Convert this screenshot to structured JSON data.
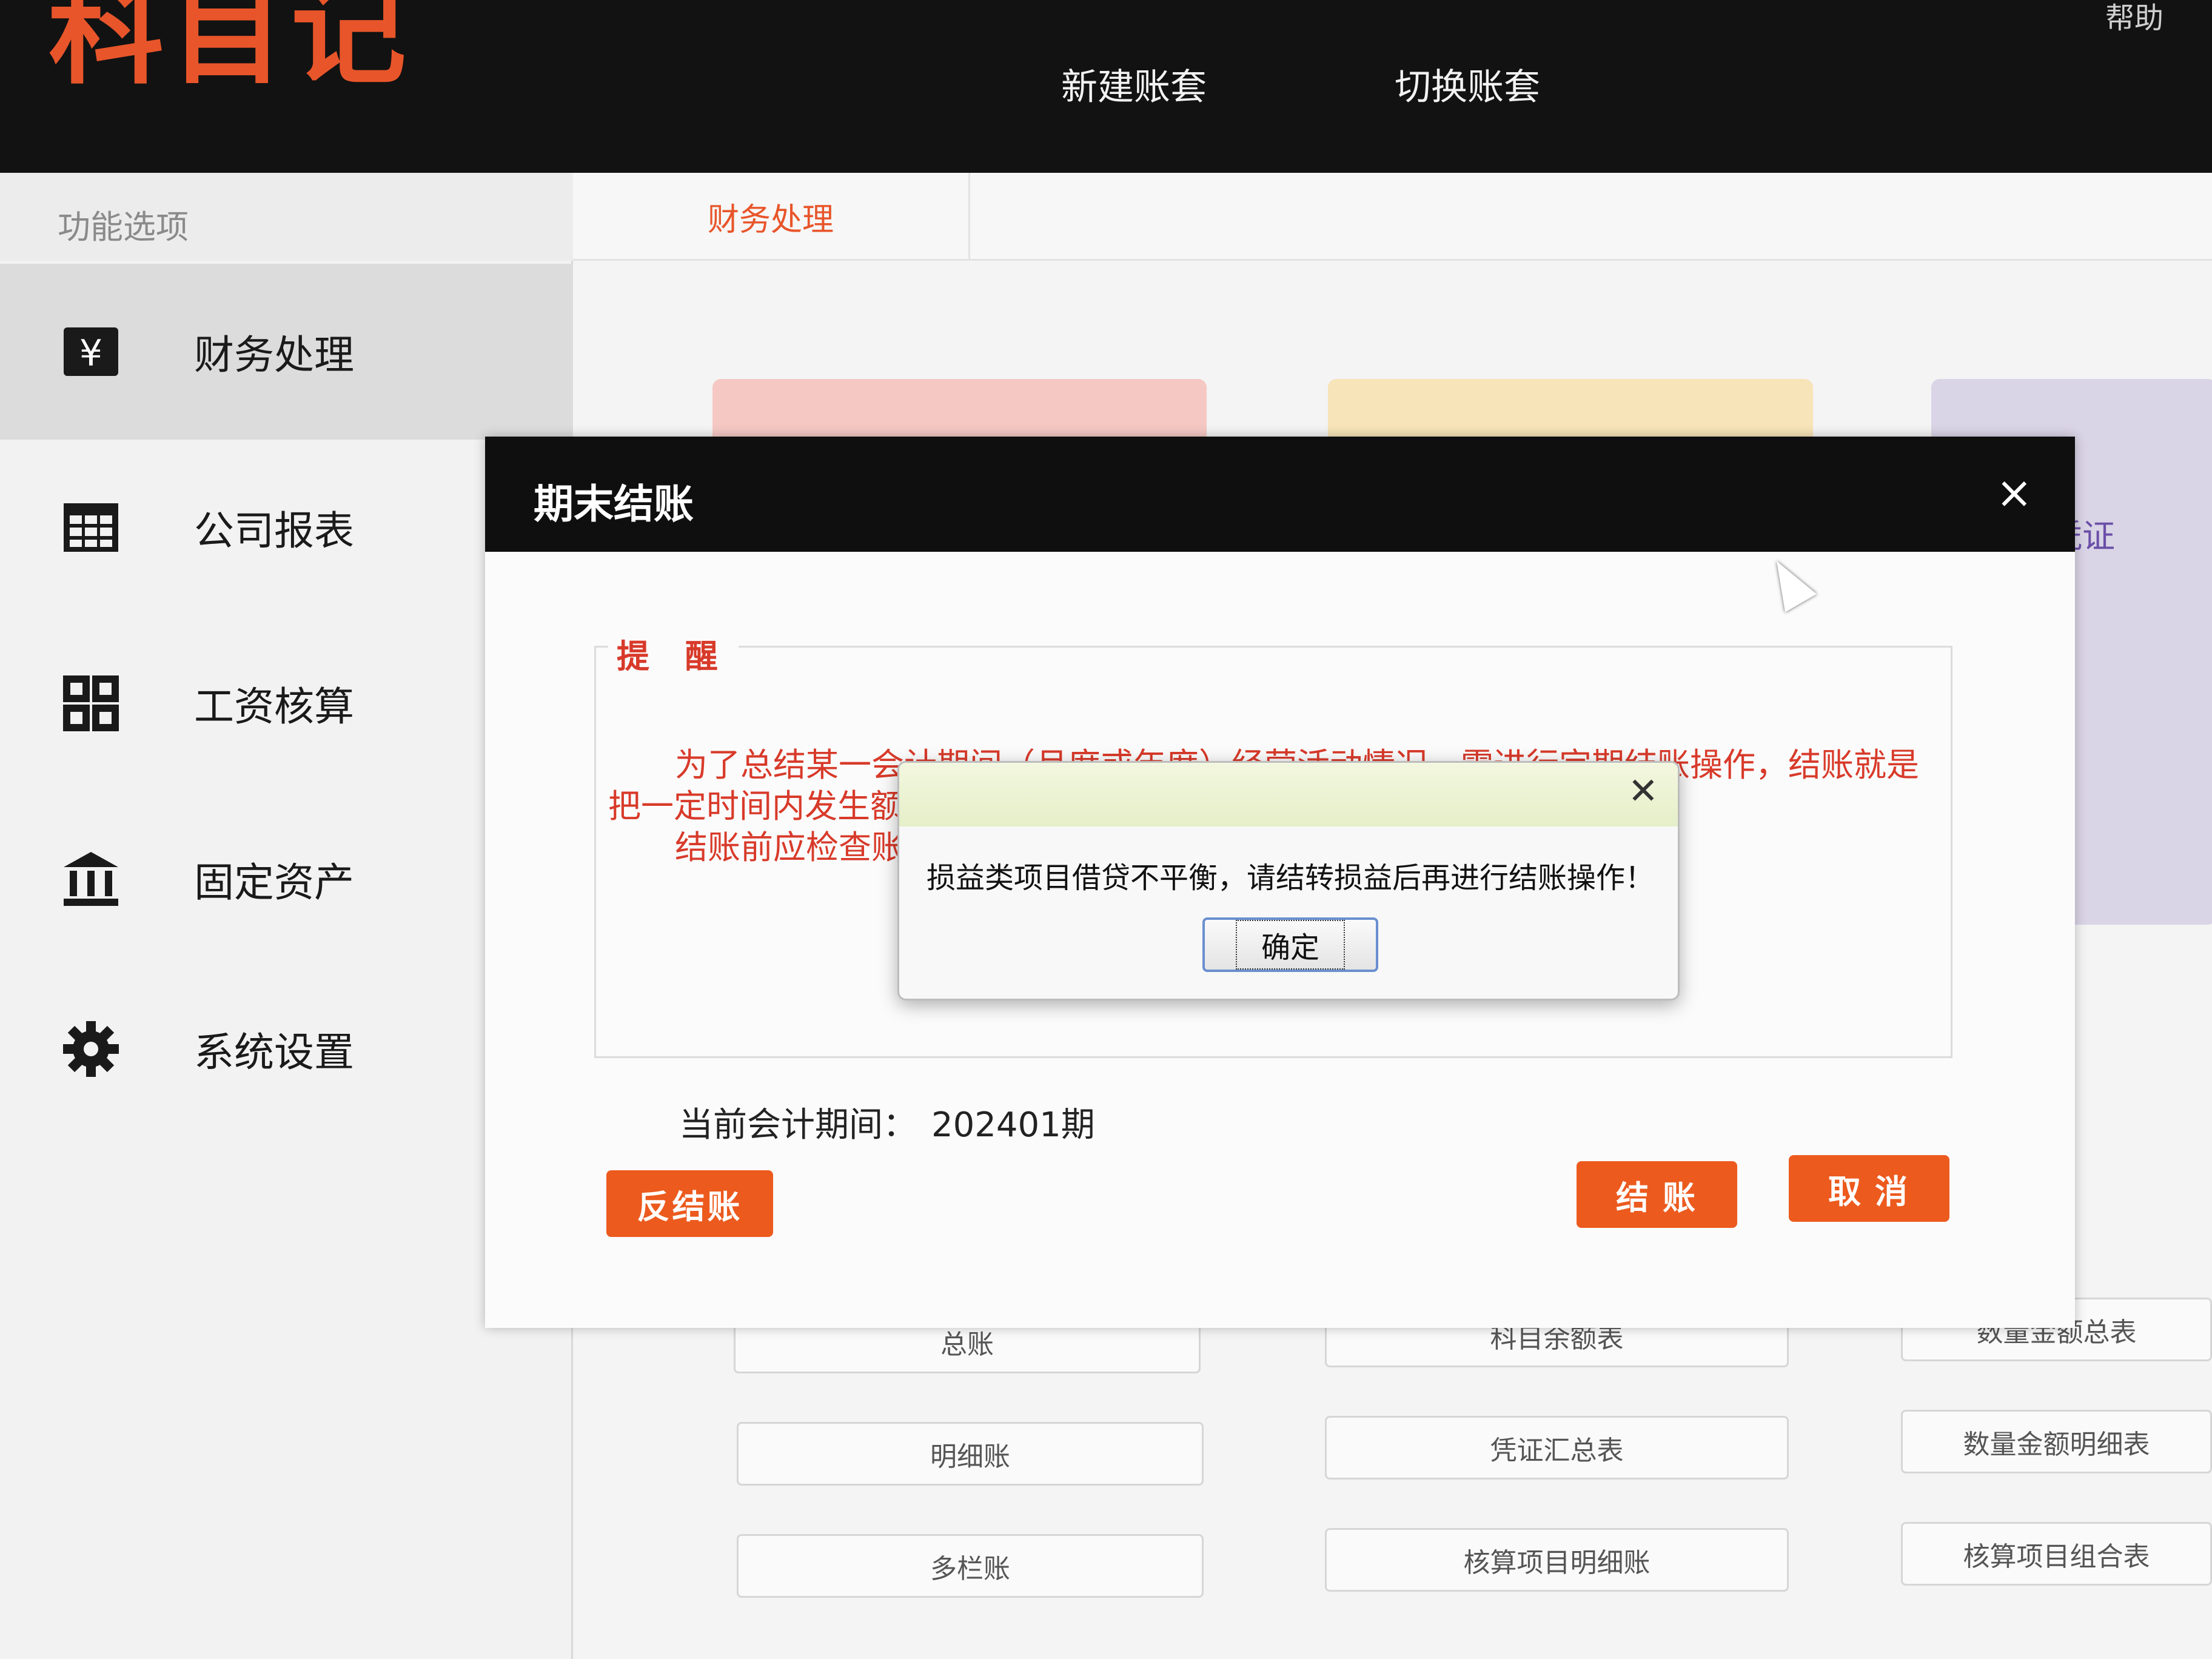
{
  "app": {
    "logo": "科目记",
    "help": "帮助"
  },
  "topnav": [
    {
      "label": "新建账套"
    },
    {
      "label": "切换账套"
    }
  ],
  "sidebar": {
    "header": "功能选项",
    "items": [
      {
        "label": "财务处理",
        "icon": "yen-box-icon"
      },
      {
        "label": "公司报表",
        "icon": "table-grid-icon"
      },
      {
        "label": "工资核算",
        "icon": "four-squares-icon"
      },
      {
        "label": "固定资产",
        "icon": "bank-building-icon"
      },
      {
        "label": "系统设置",
        "icon": "gear-icon"
      }
    ]
  },
  "main": {
    "tab": "财务处理",
    "card_voucher_label": "凭证",
    "reports": [
      [
        "总账",
        "科目余额表",
        "数量金额总表"
      ],
      [
        "明细账",
        "凭证汇总表",
        "数量金额明细表"
      ],
      [
        "多栏账",
        "核算项目明细账",
        "核算项目组合表"
      ]
    ]
  },
  "modal": {
    "title": "期末结账",
    "close": "×",
    "notice_title": "提 醒",
    "notice_p1": "为了总结某一会计期间（月度或年度）经营活动情况，需进行定期结账操作，结账就是把一定时间内发生额和期末余额，从而根据账簿记录",
    "notice_p2": "结账前应检查账，对各种成本费用类账户，也应在",
    "period_label": "当前会计期间：",
    "period_value": "202401期",
    "btn_unclose": "反结账",
    "btn_close": "结 账",
    "btn_cancel": "取 消"
  },
  "alert": {
    "close": "✕",
    "message": "损益类项目借贷不平衡，请结转损益后再进行结账操作！",
    "ok": "确定"
  },
  "colors": {
    "accent": "#ec5a1e",
    "notice_red": "#d83a2a",
    "topbar": "#121212"
  }
}
